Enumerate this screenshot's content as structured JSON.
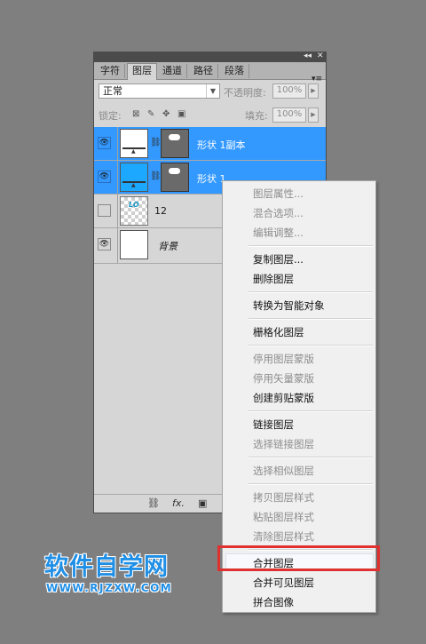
{
  "panel": {
    "titlebar": {
      "collapse_glyph": "◂◂",
      "close_glyph": "✕"
    },
    "tabs": [
      "字符",
      "图层",
      "通道",
      "路径",
      "段落"
    ],
    "active_tab": "图层",
    "menu_glyph": "▾≡",
    "blend_mode": "正常",
    "opacity_label": "不透明度:",
    "opacity_value": "100%",
    "lock_label": "锁定:",
    "fill_label": "填充:",
    "fill_value": "100%",
    "layers": [
      {
        "name": "形状 1副本",
        "selected": true
      },
      {
        "name": "形状 1",
        "selected": true
      },
      {
        "name": "12",
        "selected": false
      },
      {
        "name": "背景",
        "selected": false
      }
    ],
    "bottom_icons": [
      "link-icon",
      "fx-icon",
      "new-layer-icon"
    ],
    "fx_label": "fx."
  },
  "context_menu": {
    "items": [
      {
        "label": "图层属性...",
        "enabled": false
      },
      {
        "label": "混合选项...",
        "enabled": false
      },
      {
        "label": "编辑调整...",
        "enabled": false
      },
      {
        "label": "复制图层...",
        "enabled": true
      },
      {
        "label": "删除图层",
        "enabled": true
      },
      {
        "label": "转换为智能对象",
        "enabled": true
      },
      {
        "label": "栅格化图层",
        "enabled": true
      },
      {
        "label": "停用图层蒙版",
        "enabled": false
      },
      {
        "label": "停用矢量蒙版",
        "enabled": false
      },
      {
        "label": "创建剪贴蒙版",
        "enabled": true
      },
      {
        "label": "链接图层",
        "enabled": true
      },
      {
        "label": "选择链接图层",
        "enabled": false
      },
      {
        "label": "选择相似图层",
        "enabled": false
      },
      {
        "label": "拷贝图层样式",
        "enabled": false
      },
      {
        "label": "粘贴图层样式",
        "enabled": false
      },
      {
        "label": "清除图层样式",
        "enabled": false
      },
      {
        "label": "合并图层",
        "enabled": true,
        "highlighted": true
      },
      {
        "label": "合并可见图层",
        "enabled": true
      },
      {
        "label": "拼合图像",
        "enabled": true
      }
    ]
  },
  "watermark": {
    "title": "软件自学网",
    "url": "WWW.RJZXW.COM"
  },
  "colors": {
    "selection": "#3399ff",
    "highlight_box": "#e03131",
    "watermark": "#1f8fe6"
  }
}
